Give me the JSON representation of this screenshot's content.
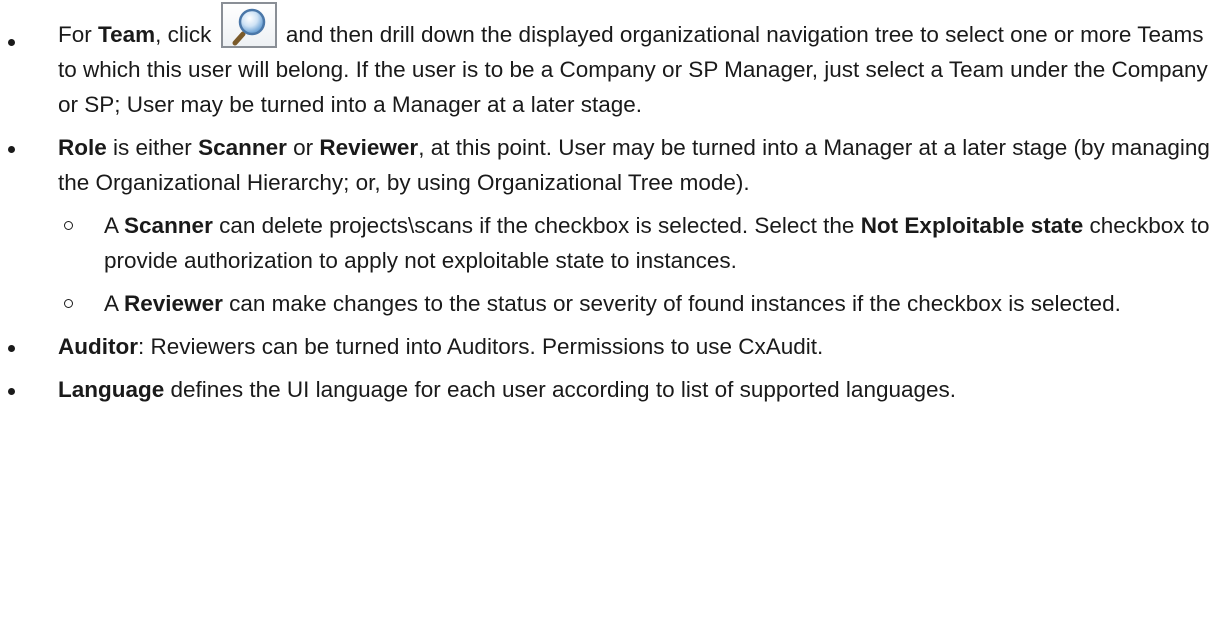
{
  "items": [
    {
      "pre": "For ",
      "bold1": "Team",
      "mid": ", click ",
      "icon": "magnifier-search-icon",
      "post": " and then drill down the displayed organizational navigation tree to select one or more Teams to which this user will belong. If the user is to be a Company or SP Manager, just select a Team under the Company or SP; User may be turned into a Manager at a later stage."
    },
    {
      "bold1": "Role",
      "t1": " is either ",
      "bold2": "Scanner",
      "t2": " or ",
      "bold3": "Reviewer",
      "t3": ", at this point. User may be turned into a Manager at a later stage (by managing the Organizational Hierarchy; or, by using Organizational Tree mode).",
      "subitems": [
        {
          "t1": "A ",
          "bold1": "Scanner",
          "t2": " can delete projects\\scans if the checkbox is selected. Select the ",
          "bold2": "Not Exploitable state",
          "t3": " checkbox to provide authorization to apply not exploitable state to instances."
        },
        {
          "t1": "A ",
          "bold1": "Reviewer",
          "t2": " can make changes to the status or severity of found instances if the checkbox is selected."
        }
      ]
    },
    {
      "bold1": "Auditor",
      "t1": ": Reviewers can be turned into Auditors. Permissions to use CxAudit."
    },
    {
      "bold1": "Language",
      "t1": " defines the UI language for each user according to list of supported languages."
    }
  ]
}
